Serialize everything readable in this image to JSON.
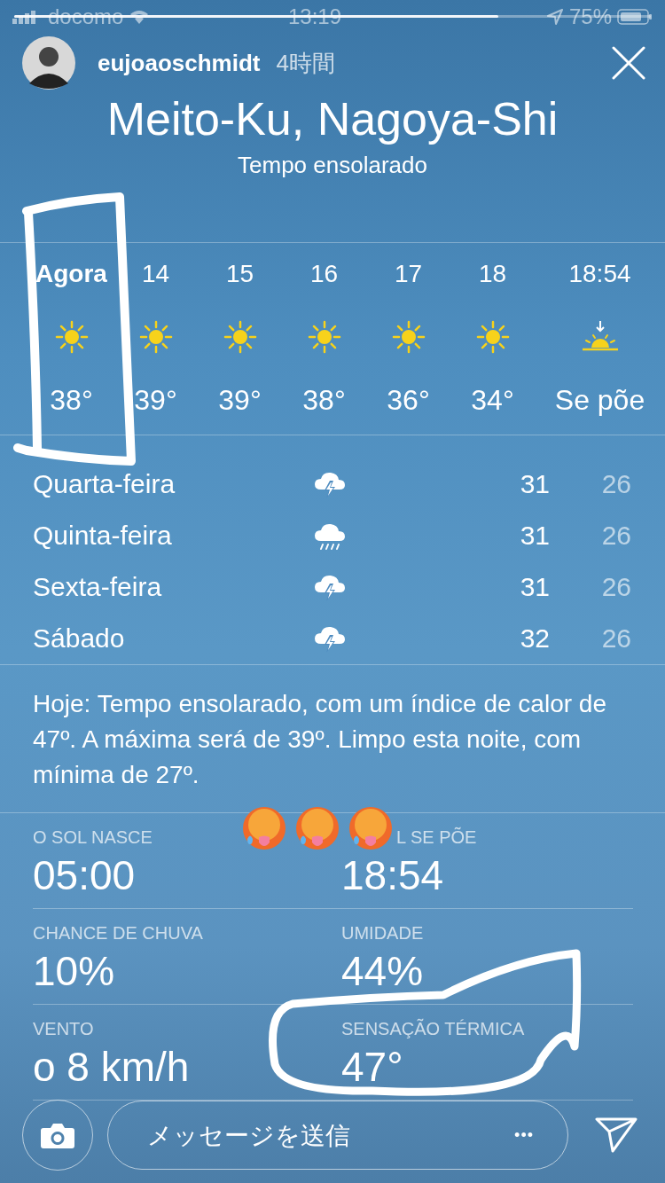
{
  "status_bar": {
    "carrier": "docomo",
    "time": "13:19",
    "battery": "75%"
  },
  "story": {
    "progress": {
      "level": 0.76
    },
    "username": "eujoaoschmidt",
    "age": "4時間"
  },
  "weather": {
    "location": "Meito-Ku, Nagoya-Shi",
    "condition": "Tempo ensolarado",
    "hourly": [
      {
        "label": "Agora",
        "kind": "sun",
        "temp": "38°",
        "current": true
      },
      {
        "label": "14",
        "kind": "sun",
        "temp": "39°",
        "current": false
      },
      {
        "label": "15",
        "kind": "sun",
        "temp": "39°",
        "current": false
      },
      {
        "label": "16",
        "kind": "sun",
        "temp": "38°",
        "current": false
      },
      {
        "label": "17",
        "kind": "sun",
        "temp": "36°",
        "current": false
      },
      {
        "label": "18",
        "kind": "sun",
        "temp": "34°",
        "current": false
      },
      {
        "label": "18:54",
        "kind": "sunset",
        "temp": "Se põe",
        "current": false
      }
    ],
    "daily": [
      {
        "day": "Quarta-feira",
        "kind": "storm",
        "high": "31",
        "low": "26"
      },
      {
        "day": "Quinta-feira",
        "kind": "rain",
        "high": "31",
        "low": "26"
      },
      {
        "day": "Sexta-feira",
        "kind": "storm",
        "high": "31",
        "low": "26"
      },
      {
        "day": "Sábado",
        "kind": "storm",
        "high": "32",
        "low": "26"
      }
    ],
    "summary": "Hoje: Tempo ensolarado, com um índice de calor de 47º. A máxima será de 39º. Limpo esta noite, com mínima de 27º.",
    "details": [
      {
        "label": "O SOL NASCE",
        "value": "05:00"
      },
      {
        "label": "L SE PÕE",
        "value": "18:54"
      },
      {
        "label": "CHANCE DE CHUVA",
        "value": "10%"
      },
      {
        "label": "UMIDADE",
        "value": "44%"
      },
      {
        "label": "VENTO",
        "value": "o 8 km/h"
      },
      {
        "label": "SENSAÇÃO TÉRMICA",
        "value": "47°"
      }
    ]
  },
  "reply_bar": {
    "placeholder": "メッセージを送信",
    "more": "•••"
  }
}
